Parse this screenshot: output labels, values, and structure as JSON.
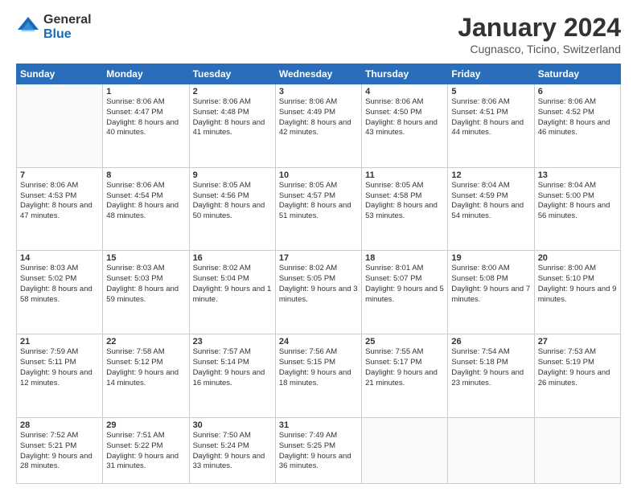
{
  "header": {
    "logo_general": "General",
    "logo_blue": "Blue",
    "month_title": "January 2024",
    "location": "Cugnasco, Ticino, Switzerland"
  },
  "days_of_week": [
    "Sunday",
    "Monday",
    "Tuesday",
    "Wednesday",
    "Thursday",
    "Friday",
    "Saturday"
  ],
  "weeks": [
    [
      {
        "num": "",
        "sunrise": "",
        "sunset": "",
        "daylight": ""
      },
      {
        "num": "1",
        "sunrise": "Sunrise: 8:06 AM",
        "sunset": "Sunset: 4:47 PM",
        "daylight": "Daylight: 8 hours and 40 minutes."
      },
      {
        "num": "2",
        "sunrise": "Sunrise: 8:06 AM",
        "sunset": "Sunset: 4:48 PM",
        "daylight": "Daylight: 8 hours and 41 minutes."
      },
      {
        "num": "3",
        "sunrise": "Sunrise: 8:06 AM",
        "sunset": "Sunset: 4:49 PM",
        "daylight": "Daylight: 8 hours and 42 minutes."
      },
      {
        "num": "4",
        "sunrise": "Sunrise: 8:06 AM",
        "sunset": "Sunset: 4:50 PM",
        "daylight": "Daylight: 8 hours and 43 minutes."
      },
      {
        "num": "5",
        "sunrise": "Sunrise: 8:06 AM",
        "sunset": "Sunset: 4:51 PM",
        "daylight": "Daylight: 8 hours and 44 minutes."
      },
      {
        "num": "6",
        "sunrise": "Sunrise: 8:06 AM",
        "sunset": "Sunset: 4:52 PM",
        "daylight": "Daylight: 8 hours and 46 minutes."
      }
    ],
    [
      {
        "num": "7",
        "sunrise": "Sunrise: 8:06 AM",
        "sunset": "Sunset: 4:53 PM",
        "daylight": "Daylight: 8 hours and 47 minutes."
      },
      {
        "num": "8",
        "sunrise": "Sunrise: 8:06 AM",
        "sunset": "Sunset: 4:54 PM",
        "daylight": "Daylight: 8 hours and 48 minutes."
      },
      {
        "num": "9",
        "sunrise": "Sunrise: 8:05 AM",
        "sunset": "Sunset: 4:56 PM",
        "daylight": "Daylight: 8 hours and 50 minutes."
      },
      {
        "num": "10",
        "sunrise": "Sunrise: 8:05 AM",
        "sunset": "Sunset: 4:57 PM",
        "daylight": "Daylight: 8 hours and 51 minutes."
      },
      {
        "num": "11",
        "sunrise": "Sunrise: 8:05 AM",
        "sunset": "Sunset: 4:58 PM",
        "daylight": "Daylight: 8 hours and 53 minutes."
      },
      {
        "num": "12",
        "sunrise": "Sunrise: 8:04 AM",
        "sunset": "Sunset: 4:59 PM",
        "daylight": "Daylight: 8 hours and 54 minutes."
      },
      {
        "num": "13",
        "sunrise": "Sunrise: 8:04 AM",
        "sunset": "Sunset: 5:00 PM",
        "daylight": "Daylight: 8 hours and 56 minutes."
      }
    ],
    [
      {
        "num": "14",
        "sunrise": "Sunrise: 8:03 AM",
        "sunset": "Sunset: 5:02 PM",
        "daylight": "Daylight: 8 hours and 58 minutes."
      },
      {
        "num": "15",
        "sunrise": "Sunrise: 8:03 AM",
        "sunset": "Sunset: 5:03 PM",
        "daylight": "Daylight: 8 hours and 59 minutes."
      },
      {
        "num": "16",
        "sunrise": "Sunrise: 8:02 AM",
        "sunset": "Sunset: 5:04 PM",
        "daylight": "Daylight: 9 hours and 1 minute."
      },
      {
        "num": "17",
        "sunrise": "Sunrise: 8:02 AM",
        "sunset": "Sunset: 5:05 PM",
        "daylight": "Daylight: 9 hours and 3 minutes."
      },
      {
        "num": "18",
        "sunrise": "Sunrise: 8:01 AM",
        "sunset": "Sunset: 5:07 PM",
        "daylight": "Daylight: 9 hours and 5 minutes."
      },
      {
        "num": "19",
        "sunrise": "Sunrise: 8:00 AM",
        "sunset": "Sunset: 5:08 PM",
        "daylight": "Daylight: 9 hours and 7 minutes."
      },
      {
        "num": "20",
        "sunrise": "Sunrise: 8:00 AM",
        "sunset": "Sunset: 5:10 PM",
        "daylight": "Daylight: 9 hours and 9 minutes."
      }
    ],
    [
      {
        "num": "21",
        "sunrise": "Sunrise: 7:59 AM",
        "sunset": "Sunset: 5:11 PM",
        "daylight": "Daylight: 9 hours and 12 minutes."
      },
      {
        "num": "22",
        "sunrise": "Sunrise: 7:58 AM",
        "sunset": "Sunset: 5:12 PM",
        "daylight": "Daylight: 9 hours and 14 minutes."
      },
      {
        "num": "23",
        "sunrise": "Sunrise: 7:57 AM",
        "sunset": "Sunset: 5:14 PM",
        "daylight": "Daylight: 9 hours and 16 minutes."
      },
      {
        "num": "24",
        "sunrise": "Sunrise: 7:56 AM",
        "sunset": "Sunset: 5:15 PM",
        "daylight": "Daylight: 9 hours and 18 minutes."
      },
      {
        "num": "25",
        "sunrise": "Sunrise: 7:55 AM",
        "sunset": "Sunset: 5:17 PM",
        "daylight": "Daylight: 9 hours and 21 minutes."
      },
      {
        "num": "26",
        "sunrise": "Sunrise: 7:54 AM",
        "sunset": "Sunset: 5:18 PM",
        "daylight": "Daylight: 9 hours and 23 minutes."
      },
      {
        "num": "27",
        "sunrise": "Sunrise: 7:53 AM",
        "sunset": "Sunset: 5:19 PM",
        "daylight": "Daylight: 9 hours and 26 minutes."
      }
    ],
    [
      {
        "num": "28",
        "sunrise": "Sunrise: 7:52 AM",
        "sunset": "Sunset: 5:21 PM",
        "daylight": "Daylight: 9 hours and 28 minutes."
      },
      {
        "num": "29",
        "sunrise": "Sunrise: 7:51 AM",
        "sunset": "Sunset: 5:22 PM",
        "daylight": "Daylight: 9 hours and 31 minutes."
      },
      {
        "num": "30",
        "sunrise": "Sunrise: 7:50 AM",
        "sunset": "Sunset: 5:24 PM",
        "daylight": "Daylight: 9 hours and 33 minutes."
      },
      {
        "num": "31",
        "sunrise": "Sunrise: 7:49 AM",
        "sunset": "Sunset: 5:25 PM",
        "daylight": "Daylight: 9 hours and 36 minutes."
      },
      {
        "num": "",
        "sunrise": "",
        "sunset": "",
        "daylight": ""
      },
      {
        "num": "",
        "sunrise": "",
        "sunset": "",
        "daylight": ""
      },
      {
        "num": "",
        "sunrise": "",
        "sunset": "",
        "daylight": ""
      }
    ]
  ]
}
